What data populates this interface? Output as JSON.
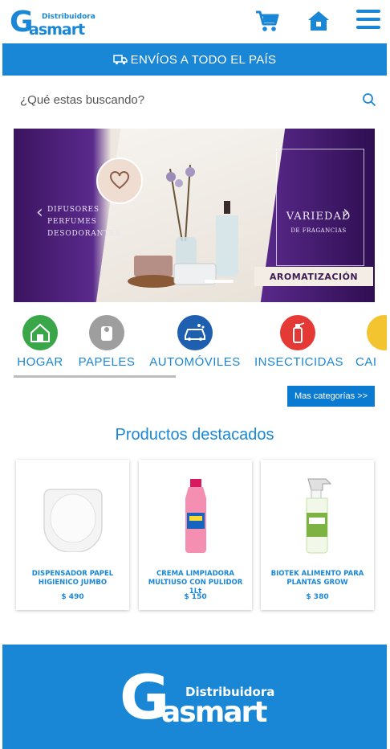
{
  "brand": {
    "distribuidora": "Distribuidora",
    "name_g": "G",
    "name_rest": "asmart"
  },
  "header": {
    "cart_icon": "cart-icon",
    "home_icon": "home-icon",
    "menu_icon": "hamburger-menu-icon"
  },
  "shipping_bar": {
    "text": "ENVÍOS A TODO EL PAÍS",
    "icon": "truck-icon"
  },
  "search": {
    "placeholder": "¿Qué estas buscando?",
    "value": "",
    "icon": "search-icon"
  },
  "hero": {
    "left_lines": [
      "DIFUSORES",
      "PERFUMES",
      "DESODORANTES"
    ],
    "right_title": "VARIEDAD",
    "right_subtitle": "DE FRAGANCIAS",
    "tag": "AROMATIZACIÓN",
    "prev": "‹",
    "next": "›"
  },
  "categories": [
    {
      "label": "HOGAR",
      "icon": "house-cleaning-icon",
      "color": "#3aa64a"
    },
    {
      "label": "PAPELES",
      "icon": "paper-roll-icon",
      "color": "#9e9e9e"
    },
    {
      "label": "AUTOMÓVILES",
      "icon": "car-wash-icon",
      "color": "#1f5fb0"
    },
    {
      "label": "INSECTICIDAS",
      "icon": "insecticide-spray-icon",
      "color": "#e53935"
    },
    {
      "label": "CAI",
      "icon": "category-icon",
      "color": "#f4c430"
    }
  ],
  "more_categories": "Mas categorías >>",
  "featured_title": "Productos destacados",
  "products": [
    {
      "name": "DISPENSADOR PAPEL HIGIENICO JUMBO",
      "price": "$ 490"
    },
    {
      "name": "CREMA LIMPIADORA MULTIUSO CON PULIDOR 1Lt",
      "price": "$ 150"
    },
    {
      "name": "BIOTEK ALIMENTO PARA PLANTAS GROW",
      "price": "$ 380"
    }
  ],
  "footer": {
    "distribuidora": "Distribuidora",
    "name_g": "G",
    "name_rest": "asmart"
  },
  "colors": {
    "brand_blue": "#1a87d6",
    "button_blue": "#0b7ad1"
  }
}
